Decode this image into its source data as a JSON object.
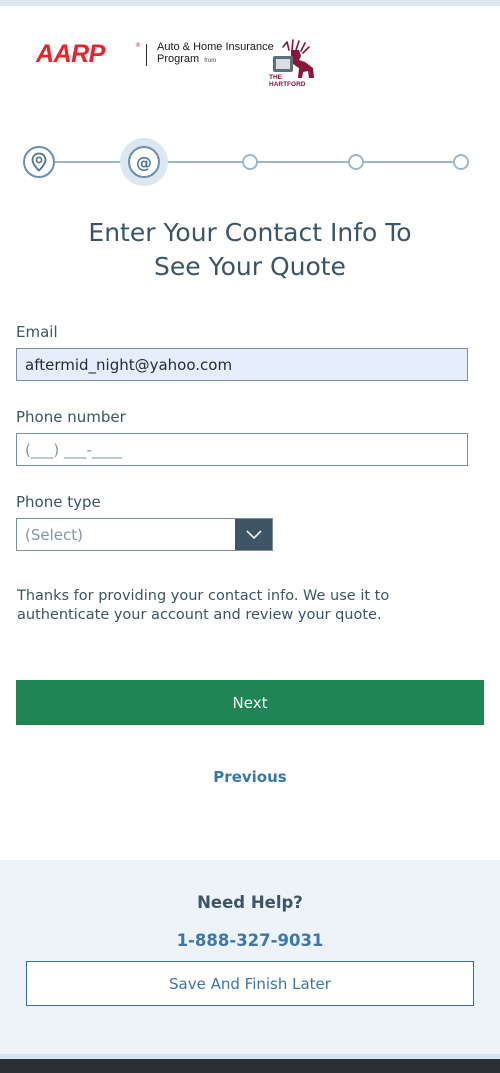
{
  "brand": {
    "aarp": "AARP",
    "program_line1": "Auto & Home Insurance",
    "program_line2": "Program",
    "program_from": "from",
    "hartford_the": "THE",
    "hartford_name": "HARTFORD",
    "hartford_icon": "stag-icon",
    "aarp_color": "#e8232a"
  },
  "stepper": {
    "current_step": 2,
    "total_steps": 5,
    "step_icons": [
      "location-pin-icon",
      "at-sign-icon"
    ],
    "current_symbol": "@"
  },
  "headline": {
    "line1": "Enter Your Contact Info To",
    "line2": "See Your Quote"
  },
  "form": {
    "email_label": "Email",
    "email_value": "aftermid_night@yahoo.com",
    "phone_label": "Phone number",
    "phone_placeholder": "(___) ___-____",
    "phone_type_label": "Phone type",
    "phone_type_value": "(Select)"
  },
  "info_text": "Thanks for providing your contact info. We use it to authenticate your account and review your quote.",
  "actions": {
    "next": "Next",
    "previous": "Previous",
    "next_color": "#1e8555"
  },
  "help": {
    "title": "Need Help?",
    "phone": "1-888-327-9031",
    "save_later": "Save And Finish Later"
  }
}
